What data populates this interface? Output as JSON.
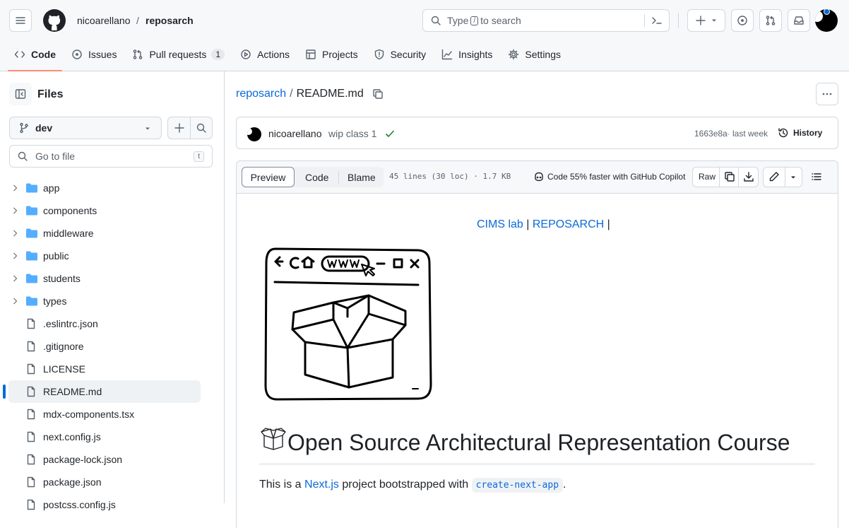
{
  "header": {
    "owner": "nicoarellano",
    "separator": "/",
    "repo": "reposarch",
    "search_prefix": "Type",
    "search_key": "/",
    "search_suffix": "to search"
  },
  "nav": {
    "tabs": [
      {
        "label": "Code",
        "icon": "code-icon"
      },
      {
        "label": "Issues",
        "icon": "issue-icon"
      },
      {
        "label": "Pull requests",
        "icon": "pull-request-icon",
        "count": "1"
      },
      {
        "label": "Actions",
        "icon": "play-icon"
      },
      {
        "label": "Projects",
        "icon": "table-icon"
      },
      {
        "label": "Security",
        "icon": "shield-icon"
      },
      {
        "label": "Insights",
        "icon": "graph-icon"
      },
      {
        "label": "Settings",
        "icon": "gear-icon"
      }
    ]
  },
  "sidebar": {
    "title": "Files",
    "branch": "dev",
    "filter_placeholder": "Go to file",
    "filter_key": "t",
    "items": [
      {
        "name": "app",
        "type": "folder"
      },
      {
        "name": "components",
        "type": "folder"
      },
      {
        "name": "middleware",
        "type": "folder"
      },
      {
        "name": "public",
        "type": "folder"
      },
      {
        "name": "students",
        "type": "folder"
      },
      {
        "name": "types",
        "type": "folder"
      },
      {
        "name": ".eslintrc.json",
        "type": "file"
      },
      {
        "name": ".gitignore",
        "type": "file"
      },
      {
        "name": "LICENSE",
        "type": "file"
      },
      {
        "name": "README.md",
        "type": "file",
        "selected": true
      },
      {
        "name": "mdx-components.tsx",
        "type": "file"
      },
      {
        "name": "next.config.js",
        "type": "file"
      },
      {
        "name": "package-lock.json",
        "type": "file"
      },
      {
        "name": "package.json",
        "type": "file"
      },
      {
        "name": "postcss.config.js",
        "type": "file"
      }
    ]
  },
  "file": {
    "repo_link": "reposarch",
    "separator": "/",
    "name": "README.md"
  },
  "commit": {
    "author": "nicoarellano",
    "message": "wip class 1",
    "sha": "1663e8a",
    "dot": "·",
    "time": "last week",
    "history_label": "History"
  },
  "toolbar": {
    "preview": "Preview",
    "code": "Code",
    "blame": "Blame",
    "stats": "45 lines (30 loc) · 1.7 KB",
    "copilot": "Code 55% faster with GitHub Copilot",
    "raw": "Raw"
  },
  "readme": {
    "link1": "CIMS lab",
    "pipe1": "|",
    "link2": "REPOSARCH",
    "pipe2": "|",
    "heading": "Open Source Architectural Representation Course",
    "p_before": "This is a",
    "p_link": "Next.js",
    "p_middle": "project bootstrapped with",
    "p_code": "create-next-app",
    "p_after": "."
  },
  "colors": {
    "accent": "#0969da",
    "selected_tab_underline": "#fd8c73",
    "folder": "#54aeff",
    "success": "#1a7f37"
  }
}
